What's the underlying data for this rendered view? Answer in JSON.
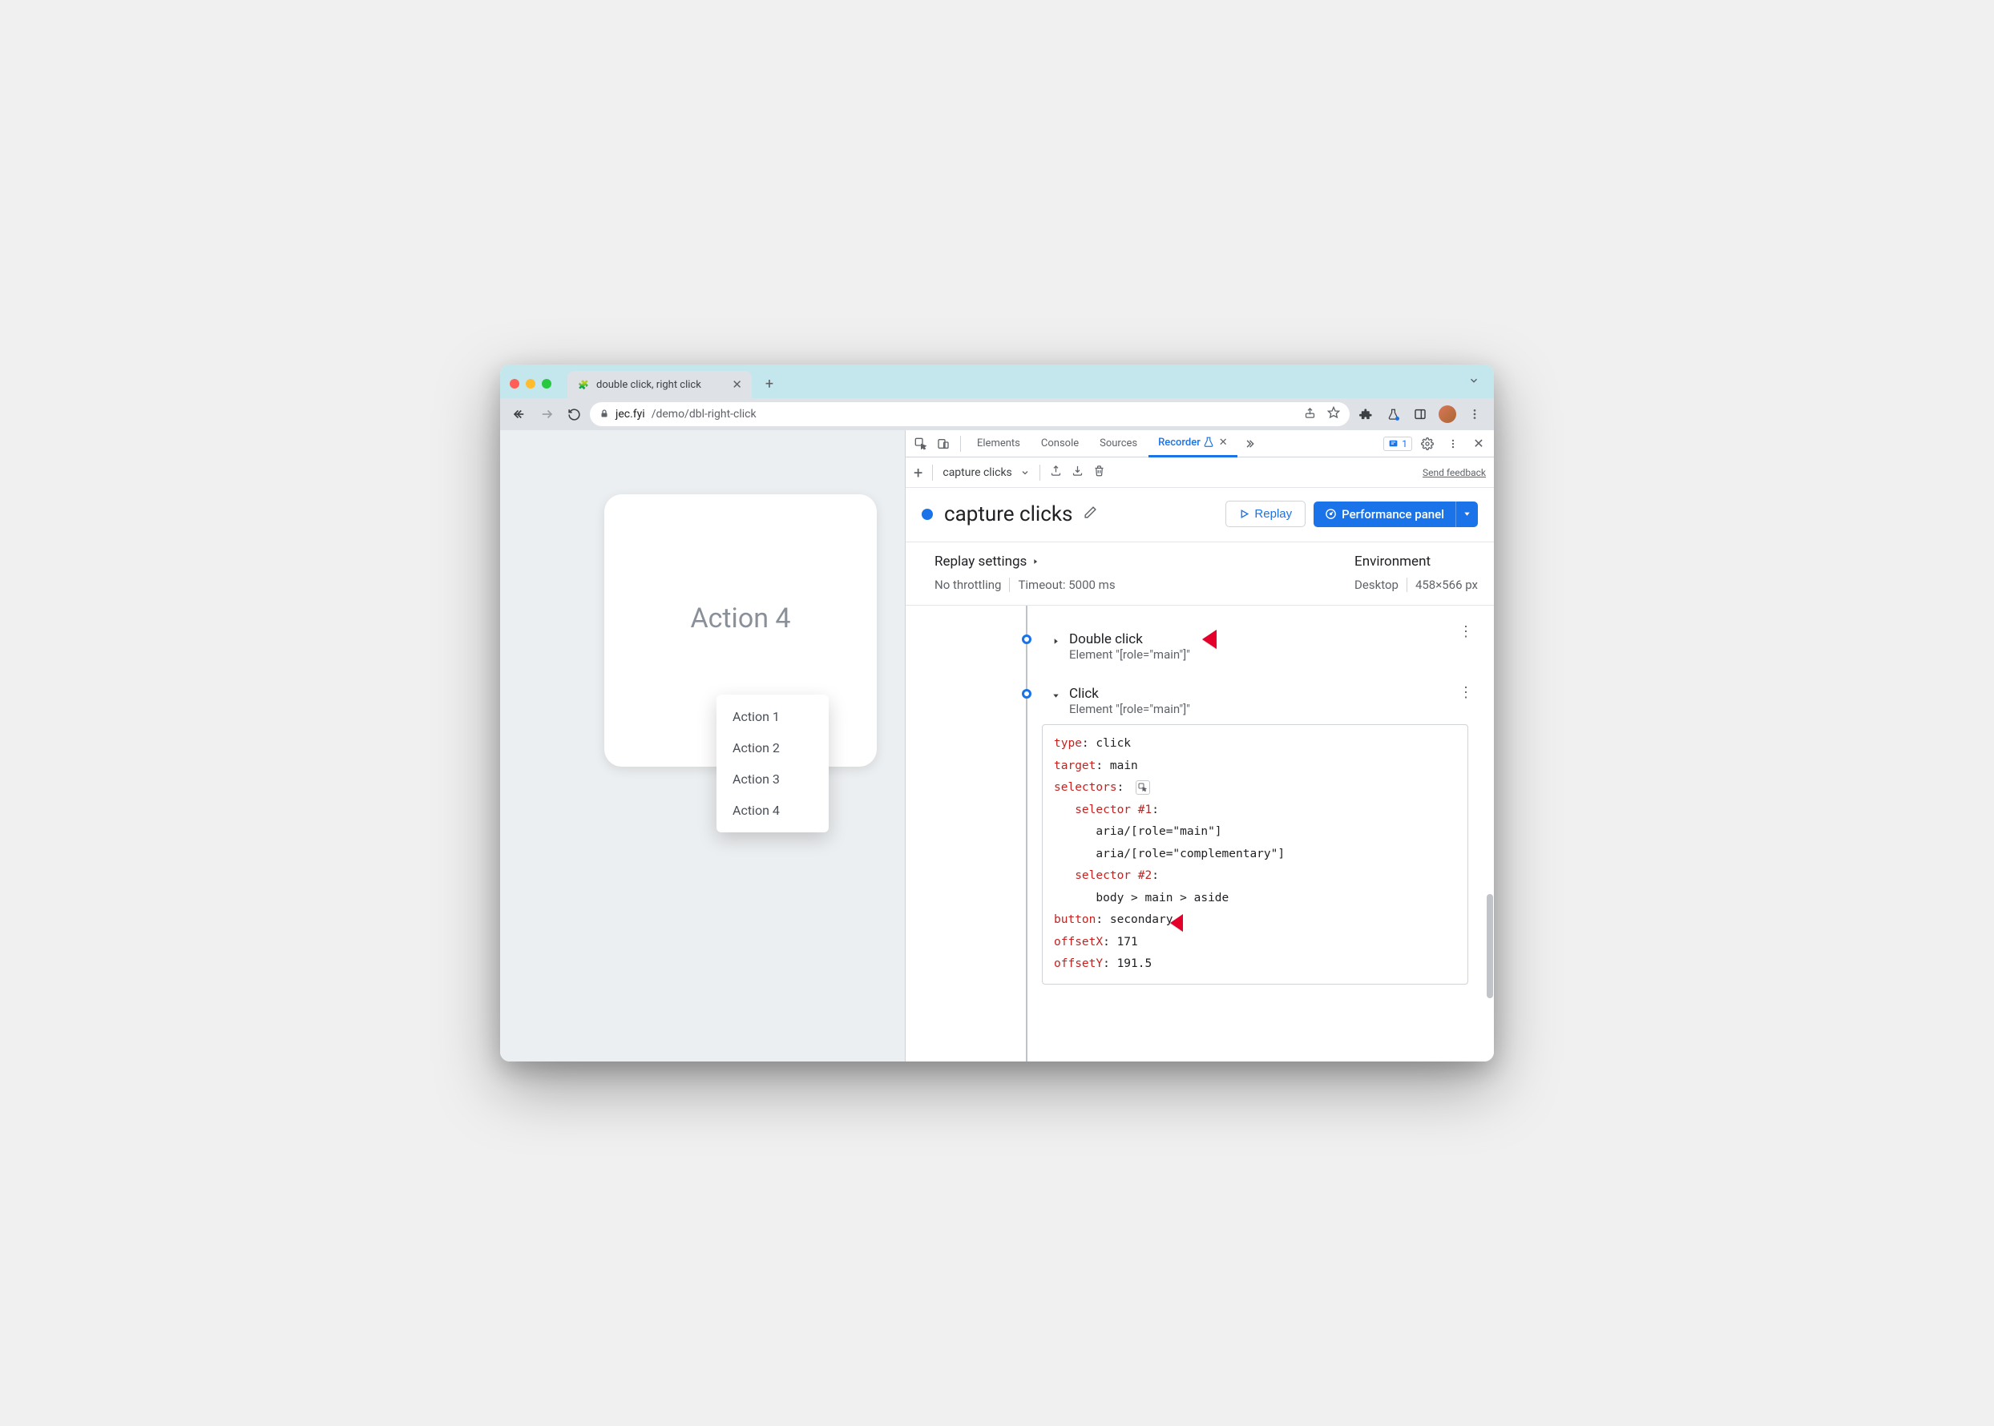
{
  "tab": {
    "title": "double click, right click",
    "favicon": "🧩"
  },
  "omnibox": {
    "url": "jec.fyi/demo/dbl-right-click",
    "domain": "jec.fyi",
    "path": "/demo/dbl-right-click"
  },
  "page": {
    "card_title": "Action 4",
    "menu_items": [
      "Action 1",
      "Action 2",
      "Action 3",
      "Action 4"
    ]
  },
  "devtools": {
    "tabs": [
      "Elements",
      "Console",
      "Sources",
      "Recorder"
    ],
    "active_tab": "Recorder",
    "issues_count": "1",
    "feedback_link": "Send feedback"
  },
  "recorder_toolbar": {
    "recording_name": "capture clicks"
  },
  "recorder_header": {
    "title": "capture clicks",
    "replay_btn": "Replay",
    "perf_btn": "Performance panel"
  },
  "settings": {
    "replay_heading": "Replay settings",
    "throttling": "No throttling",
    "timeout": "Timeout: 5000 ms",
    "env_heading": "Environment",
    "device": "Desktop",
    "viewport": "458×566 px"
  },
  "steps": [
    {
      "title": "Double click",
      "subtitle": "Element \"[role=\"main\"]\"",
      "expanded": false
    },
    {
      "title": "Click",
      "subtitle": "Element \"[role=\"main\"]\"",
      "expanded": true,
      "detail": {
        "type_key": "type",
        "type_val": "click",
        "target_key": "target",
        "target_val": "main",
        "selectors_key": "selectors",
        "sel1_key": "selector #1",
        "sel1_lines": [
          "aria/[role=\"main\"]",
          "aria/[role=\"complementary\"]"
        ],
        "sel2_key": "selector #2",
        "sel2_lines": [
          "body > main > aside"
        ],
        "button_key": "button",
        "button_val": "secondary",
        "offsetX_key": "offsetX",
        "offsetX_val": "171",
        "offsetY_key": "offsetY",
        "offsetY_val": "191.5"
      }
    }
  ]
}
